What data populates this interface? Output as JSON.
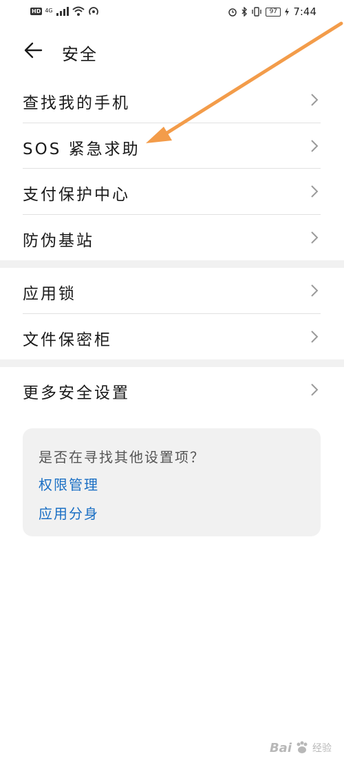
{
  "status_bar": {
    "hd": "HD",
    "network": "4G",
    "battery": "97",
    "time": "7:44"
  },
  "header": {
    "title": "安全",
    "back_icon": "arrow-left-icon"
  },
  "menu": {
    "items": [
      {
        "label": "查找我的手机"
      },
      {
        "label": "SOS 紧急求助"
      },
      {
        "label": "支付保护中心"
      },
      {
        "label": "防伪基站"
      },
      {
        "label": "应用锁"
      },
      {
        "label": "文件保密柜"
      },
      {
        "label": "更多安全设置"
      }
    ]
  },
  "suggest": {
    "title": "是否在寻找其他设置项？",
    "links": [
      {
        "label": "权限管理"
      },
      {
        "label": "应用分身"
      }
    ]
  },
  "colors": {
    "link": "#1a6fc4",
    "annotation_arrow": "#f39c4a"
  },
  "watermark": {
    "brand": "Bai",
    "sub": "经验"
  }
}
